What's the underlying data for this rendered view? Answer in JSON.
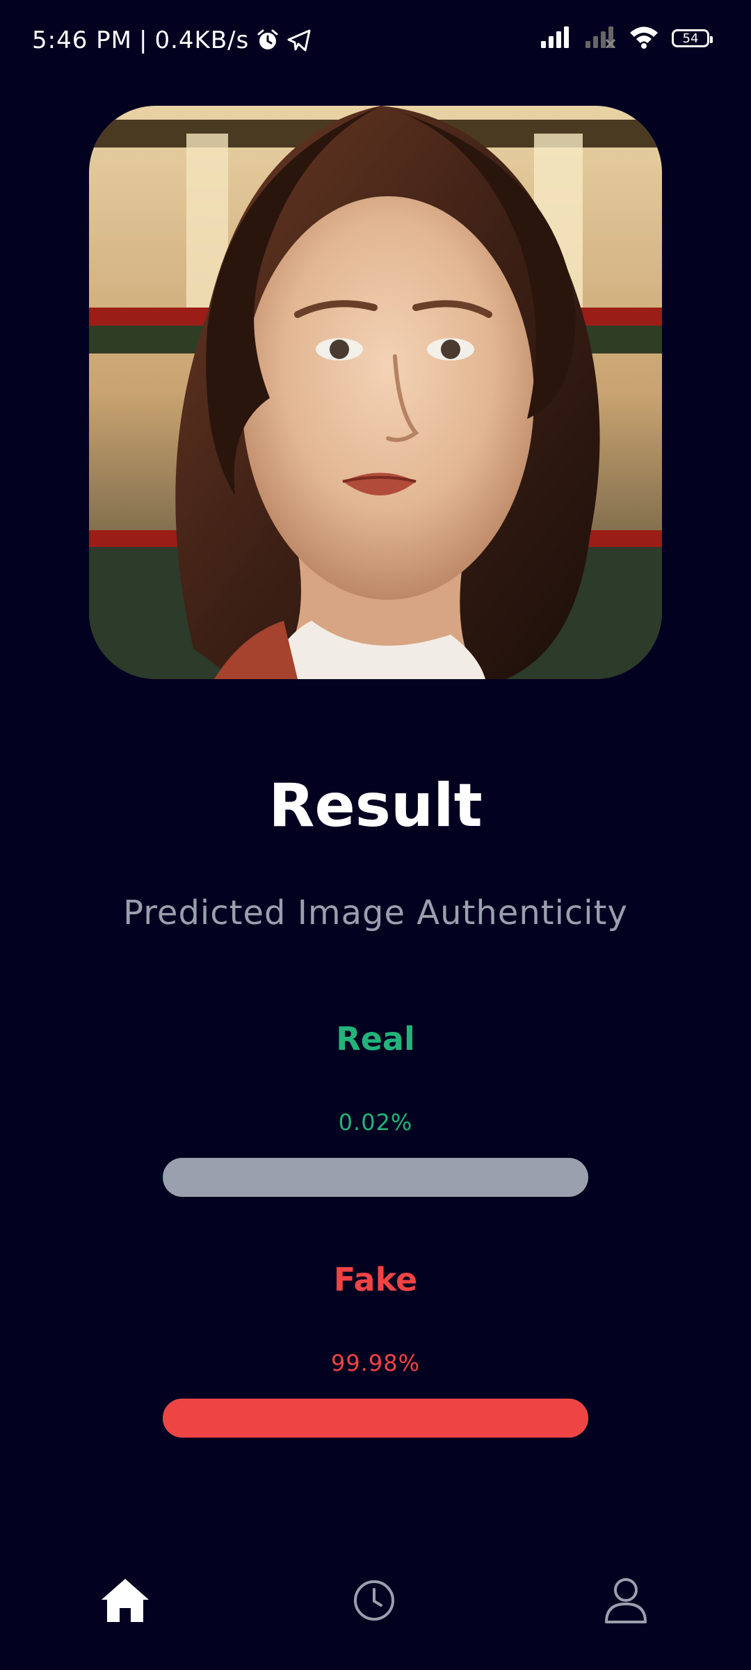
{
  "status_bar": {
    "time": "5:46 PM",
    "separator": "|",
    "network_speed": "0.4KB/s",
    "icons": [
      "alarm-icon",
      "telegram-icon",
      "signal-icon",
      "signal-weak-icon",
      "wifi-icon",
      "battery-icon"
    ],
    "battery_level": "54"
  },
  "photo": {
    "description_icon": "portrait-photo"
  },
  "result": {
    "title": "Result",
    "subtitle": "Predicted Image Authenticity",
    "real": {
      "label": "Real",
      "value_text": "0.02%",
      "fraction": 0.0002,
      "color": "#22b47a"
    },
    "fake": {
      "label": "Fake",
      "value_text": "99.98%",
      "fraction": 0.9998,
      "color": "#ef4444"
    },
    "track_color": "#9aa0ad"
  },
  "nav": {
    "items": [
      {
        "name": "home-icon",
        "active": true
      },
      {
        "name": "history-icon",
        "active": false
      },
      {
        "name": "profile-icon",
        "active": false
      }
    ]
  },
  "colors": {
    "background": "#030120",
    "subtitle": "#9aa0ad"
  }
}
